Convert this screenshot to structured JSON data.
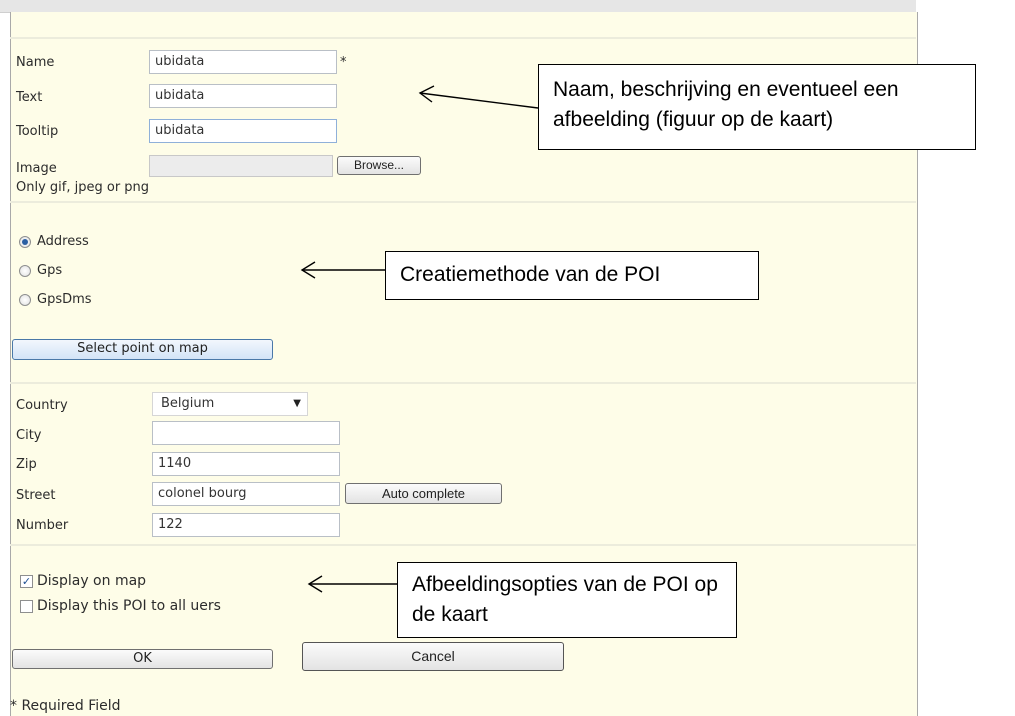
{
  "form": {
    "name_label": "Name",
    "name_value": "ubidata",
    "required_mark": "*",
    "text_label": "Text",
    "text_value": "ubidata",
    "tooltip_label": "Tooltip",
    "tooltip_value": "ubidata",
    "image_label": "Image",
    "image_value": "",
    "browse_label": "Browse...",
    "image_hint": "Only gif, jpeg or png"
  },
  "method": {
    "options": [
      "Address",
      "Gps",
      "GpsDms"
    ],
    "selected": "Address",
    "select_point_label": "Select point on map"
  },
  "address": {
    "country_label": "Country",
    "country_value": "Belgium",
    "city_label": "City",
    "city_value": "",
    "zip_label": "Zip",
    "zip_value": "1140",
    "street_label": "Street",
    "street_value": "colonel bourg",
    "auto_complete_label": "Auto complete",
    "number_label": "Number",
    "number_value": "122"
  },
  "display": {
    "display_on_map_label": "Display on map",
    "display_on_map_checked": true,
    "display_all_users_label": "Display this POI to all uers",
    "display_all_users_checked": false
  },
  "actions": {
    "ok_label": "OK",
    "cancel_label": "Cancel"
  },
  "footer": {
    "required_note": "* Required Field"
  },
  "callouts": {
    "details": "Naam, beschrijving en eventueel een afbeelding (figuur op de kaart)",
    "method": "Creatiemethode van de POI",
    "display": "Afbeeldingsopties van de POI op de kaart"
  }
}
